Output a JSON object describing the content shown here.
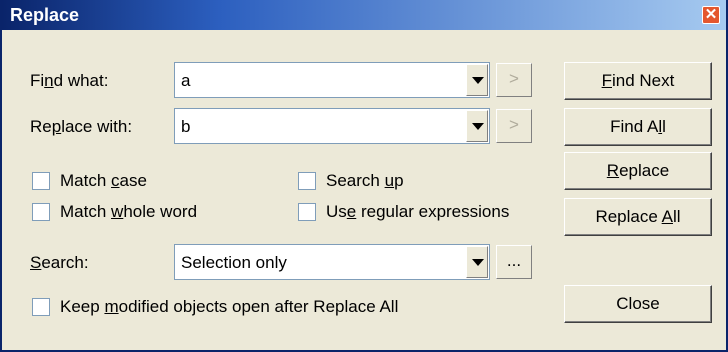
{
  "window": {
    "title": "Replace"
  },
  "find": {
    "label_pre": "Fi",
    "label_u": "n",
    "label_post": "d what:",
    "value": "a",
    "arrow": ">"
  },
  "replace": {
    "label_pre": "Re",
    "label_u": "p",
    "label_post": "lace with:",
    "value": "b",
    "arrow": ">"
  },
  "options": {
    "match_case": {
      "pre": "Match ",
      "u": "c",
      "post": "ase"
    },
    "match_whole_word": {
      "pre": "Match ",
      "u": "w",
      "post": "hole word"
    },
    "search_up": {
      "pre": "Search ",
      "u": "u",
      "post": "p"
    },
    "use_regex": {
      "pre": "Us",
      "u": "e",
      "post": " regular expressions"
    }
  },
  "search": {
    "label_pre": "",
    "label_u": "S",
    "label_post": "earch:",
    "value": "Selection only",
    "browse": "..."
  },
  "keep_open": {
    "pre": "Keep ",
    "u": "m",
    "post": "odified objects open after Replace All"
  },
  "buttons": {
    "find_next": {
      "pre": "",
      "u": "F",
      "post": "ind Next"
    },
    "find_all": {
      "pre": "Find A",
      "u": "l",
      "post": "l"
    },
    "replace": {
      "pre": "",
      "u": "R",
      "post": "eplace"
    },
    "replace_all": {
      "pre": "Replace ",
      "u": "A",
      "post": "ll"
    },
    "close": {
      "label": "Close"
    }
  }
}
